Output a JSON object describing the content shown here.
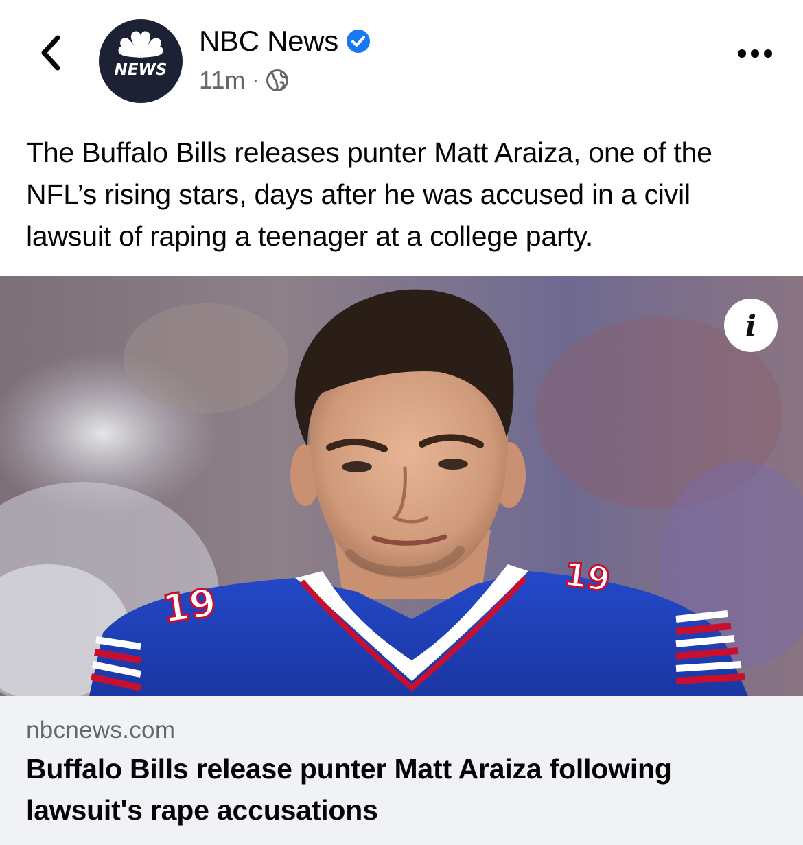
{
  "header": {
    "page_name": "NBC News",
    "timestamp": "11m",
    "separator": "·",
    "avatar_text": "NEWS",
    "verified_icon": "verified-badge-icon",
    "audience_icon": "globe-icon",
    "back_icon": "chevron-left-icon",
    "more_icon": "more-horizontal-icon"
  },
  "post": {
    "text": "The Buffalo Bills releases punter Matt Araiza, one of the NFL’s rising stars, days after he was accused in a civil lawsuit of raping a teenager at a college party."
  },
  "photo": {
    "info_label": "i",
    "jersey_number": "19"
  },
  "link_preview": {
    "domain": "nbcnews.com",
    "title": "Buffalo Bills release punter Matt Araiza following lawsuit's rape accusations"
  },
  "colors": {
    "verified_blue": "#1877f2",
    "secondary_text": "#65676b",
    "card_background": "#f0f2f5",
    "avatar_background": "#1c2233",
    "jersey_blue": "#1d3fb7",
    "jersey_red": "#c8102e"
  }
}
